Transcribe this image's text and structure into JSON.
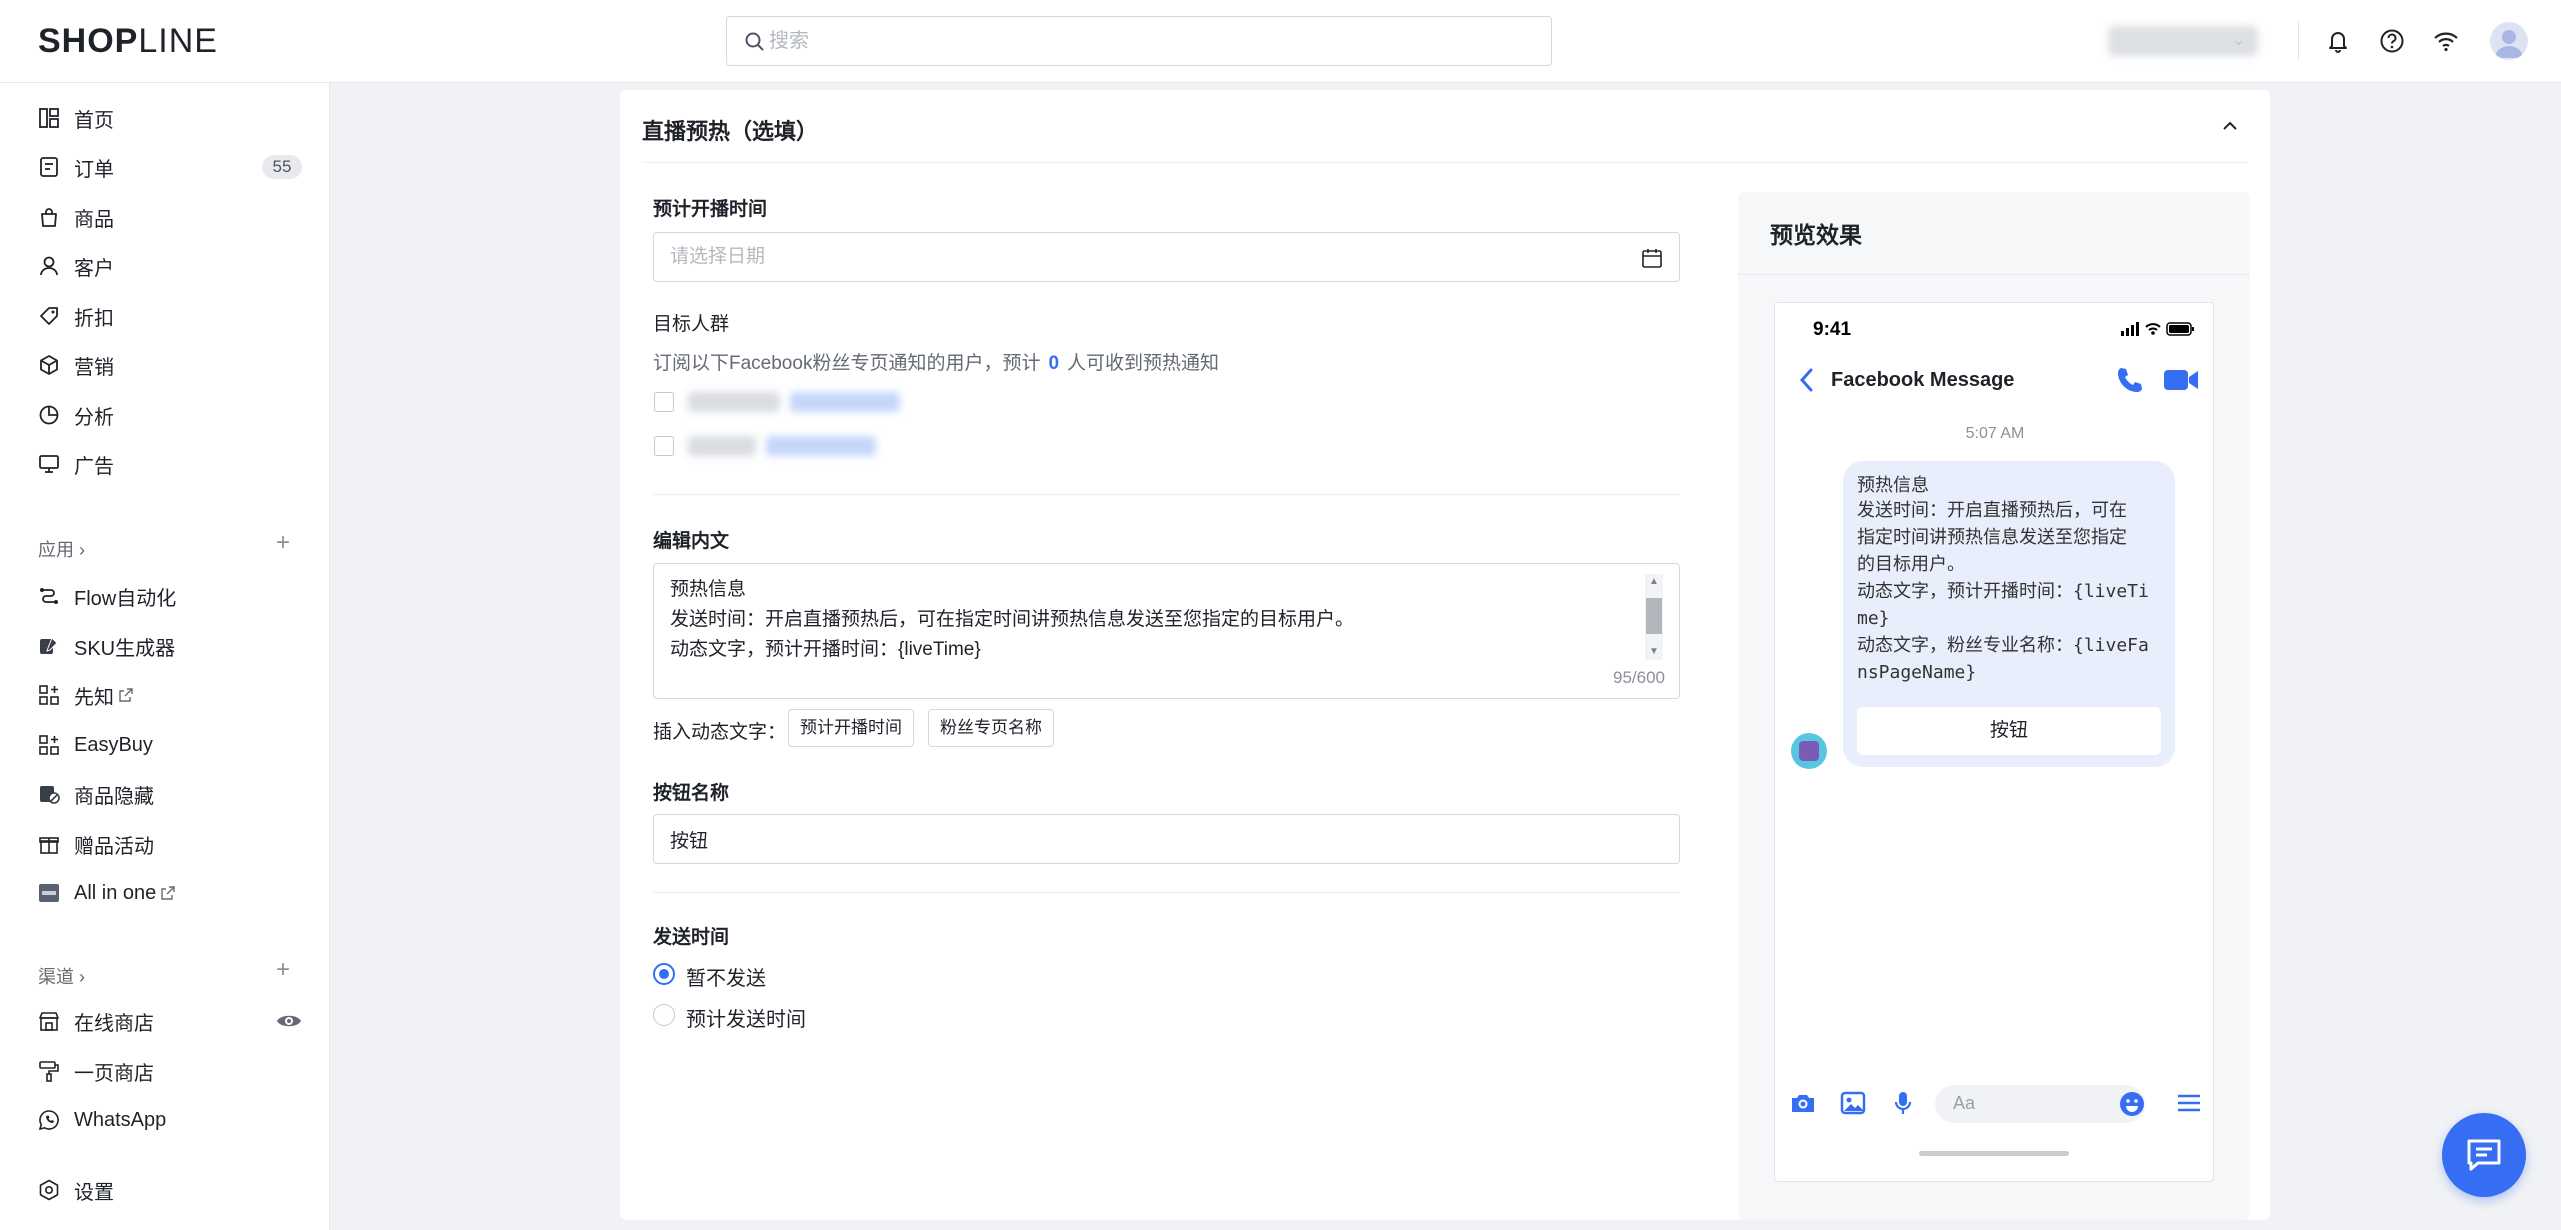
{
  "header": {
    "logo_bold": "SHOP",
    "logo_light": "LINE",
    "search_placeholder": "搜索"
  },
  "sidebar": {
    "main_items": [
      {
        "label": "首页",
        "icon": "dashboard-icon"
      },
      {
        "label": "订单",
        "icon": "order-icon",
        "badge": "55"
      },
      {
        "label": "商品",
        "icon": "product-bag-icon"
      },
      {
        "label": "客户",
        "icon": "user-icon"
      },
      {
        "label": "折扣",
        "icon": "tag-icon"
      },
      {
        "label": "营销",
        "icon": "cube-icon"
      },
      {
        "label": "分析",
        "icon": "pie-chart-icon"
      },
      {
        "label": "广告",
        "icon": "monitor-icon"
      }
    ],
    "apps_title": "应用",
    "app_items": [
      {
        "label": "Flow自动化"
      },
      {
        "label": "SKU生成器"
      },
      {
        "label": "先知"
      },
      {
        "label": "EasyBuy"
      },
      {
        "label": "商品隐藏"
      },
      {
        "label": "赠品活动"
      },
      {
        "label": "All in one"
      }
    ],
    "channels_title": "渠道",
    "channel_items": [
      {
        "label": "在线商店"
      },
      {
        "label": "一页商店"
      },
      {
        "label": "WhatsApp"
      }
    ],
    "settings_label": "设置"
  },
  "form": {
    "section_title": "直播预热（选填）",
    "schedule_label": "预计开播时间",
    "schedule_placeholder": "请选择日期",
    "audience_label": "目标人群",
    "audience_hint_pre": "订阅以下Facebook粉丝专页通知的用户，预计",
    "audience_count": "0",
    "audience_hint_post": "人可收到预热通知",
    "edit_label": "编辑内文",
    "body_lines": [
      "预热信息",
      "发送时间：开启直播预热后，可在指定时间讲预热信息发送至您指定的目标用户。",
      "动态文字，预计开播时间：{liveTime}"
    ],
    "char_count": "95/600",
    "insert_label": "插入动态文字：",
    "insert_btn_time": "预计开播时间",
    "insert_btn_page": "粉丝专页名称",
    "button_name_label": "按钮名称",
    "button_name_value": "按钮",
    "send_time_label": "发送时间",
    "send_option_now": "暂不发送",
    "send_option_schedule": "预计发送时间"
  },
  "preview": {
    "title": "预览效果",
    "clock": "9:41",
    "chat_name": "Facebook Message",
    "timestamp": "5:07 AM",
    "msg_title": "预热信息",
    "msg_lines": [
      "发送时间：开启直播预热后，可在",
      "指定时间讲预热信息发送至您指定",
      "的目标用户。",
      "动态文字，预计开播时间：{liveTi",
      "me}",
      "动态文字，粉丝专业名称：{liveFa",
      "nsPageName}"
    ],
    "msg_button": "按钮",
    "compose_placeholder": "Aa"
  },
  "colors": {
    "accent": "#356df3"
  }
}
